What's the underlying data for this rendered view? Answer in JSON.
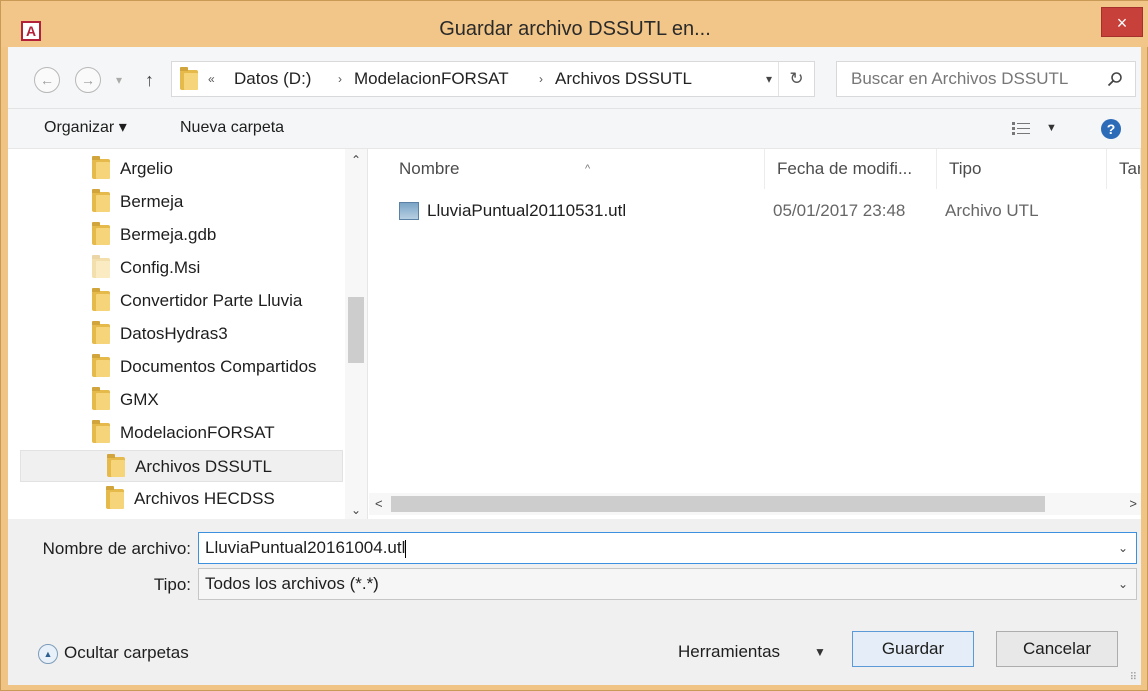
{
  "window": {
    "title": "Guardar archivo DSSUTL en...",
    "app_icon_letter": "A",
    "close_glyph": "×"
  },
  "address": {
    "overflow": "«",
    "crumbs": [
      "Datos (D:)",
      "ModelacionFORSAT",
      "Archivos DSSUTL"
    ],
    "separator": "›",
    "search_placeholder": "Buscar en Archivos DSSUTL"
  },
  "toolbar": {
    "organize": "Organizar ▾",
    "new_folder": "Nueva carpeta",
    "help": "?"
  },
  "tree": {
    "items": [
      {
        "label": "Argelio"
      },
      {
        "label": "Bermeja"
      },
      {
        "label": "Bermeja.gdb"
      },
      {
        "label": "Config.Msi"
      },
      {
        "label": "Convertidor Parte Lluvia"
      },
      {
        "label": "DatosHydras3"
      },
      {
        "label": "Documentos Compartidos"
      },
      {
        "label": "GMX"
      },
      {
        "label": "ModelacionFORSAT"
      },
      {
        "label": "Archivos DSSUTL"
      },
      {
        "label": "Archivos HECDSS"
      }
    ]
  },
  "files": {
    "columns": [
      "Nombre",
      "Fecha de modifi...",
      "Tipo",
      "Tar"
    ],
    "rows": [
      {
        "name": "LluviaPuntual20110531.utl",
        "date": "05/01/2017 23:48",
        "type": "Archivo UTL"
      }
    ]
  },
  "form": {
    "name_label": "Nombre de archivo:",
    "name_value": "LluviaPuntual20161004.utl",
    "type_label": "Tipo:",
    "type_value": "Todos los archivos (*.*)",
    "hide_folders": "Ocultar carpetas",
    "tools": "Herramientas",
    "save": "Guardar",
    "cancel": "Cancelar"
  },
  "colors": {
    "titlebar": "#f2c688",
    "close": "#c7403a",
    "folder": "#e5b94a"
  }
}
